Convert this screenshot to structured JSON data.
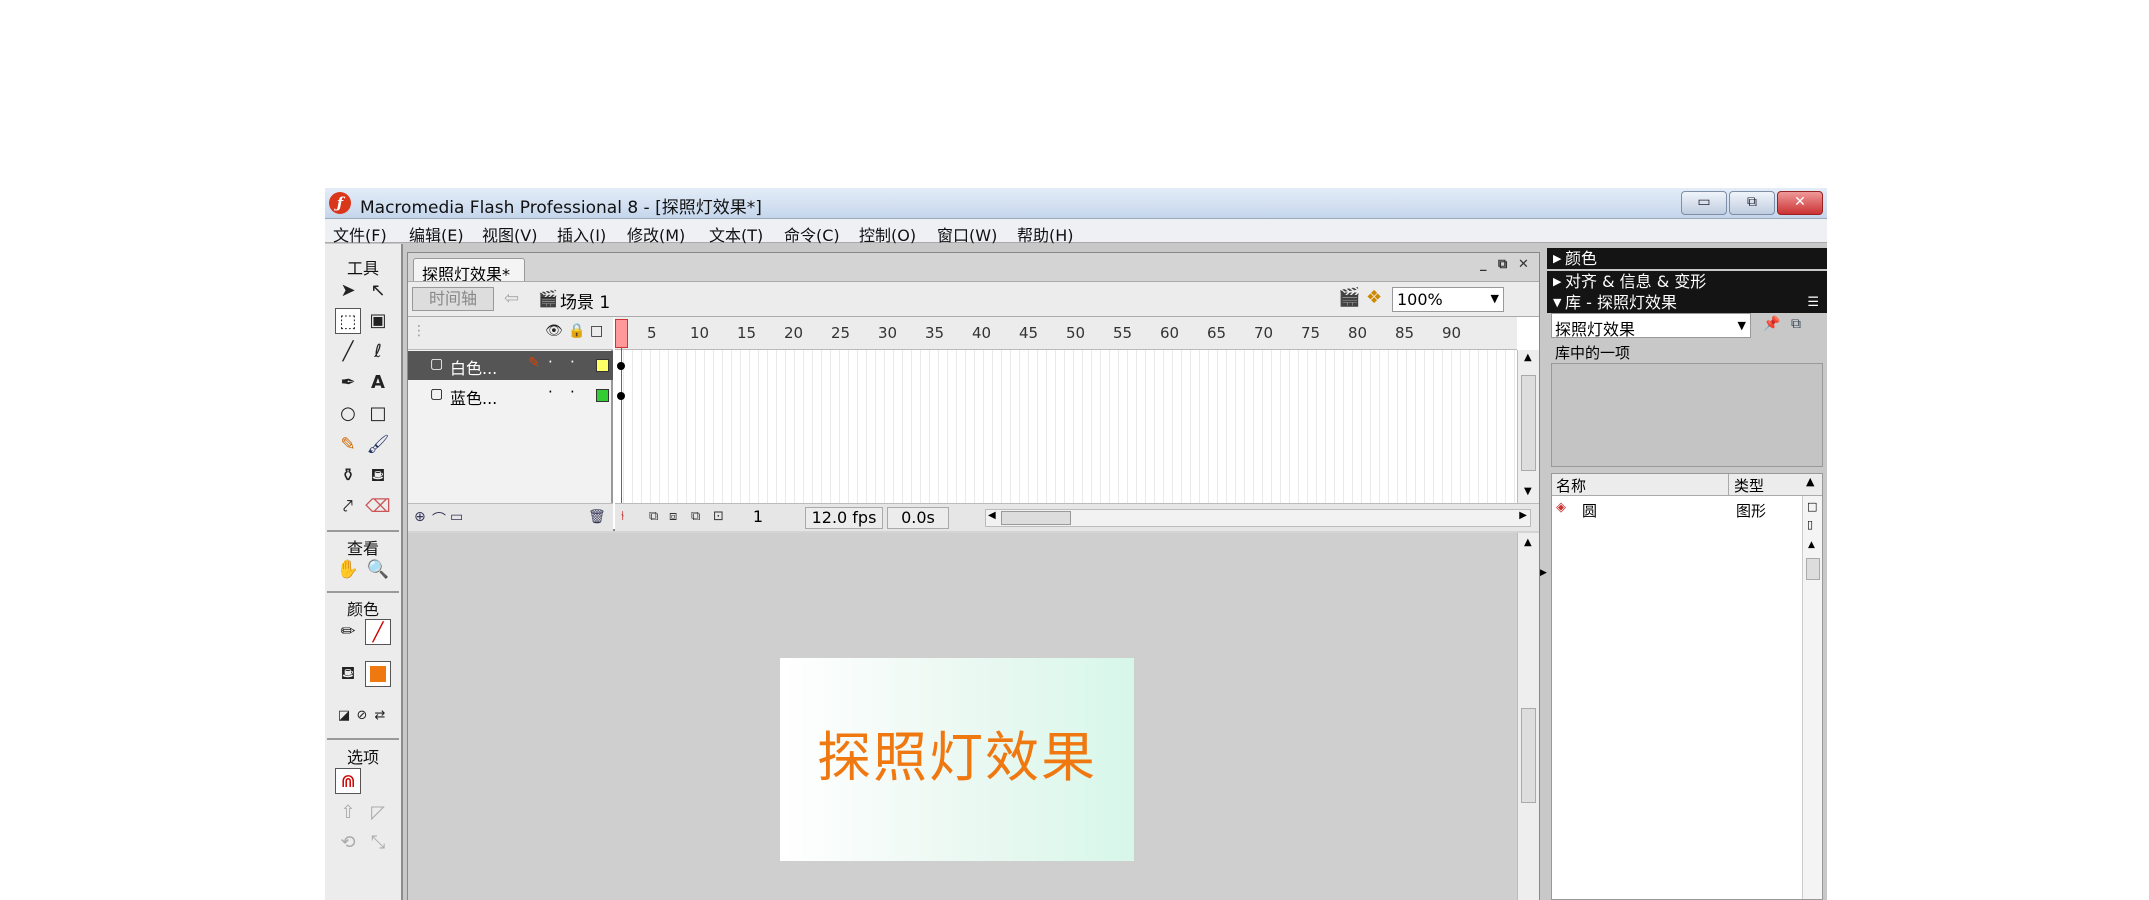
{
  "window": {
    "title": "Macromedia Flash Professional 8 - [探照灯效果*]",
    "logo_glyph": "ƒ",
    "controls": {
      "minimize": "▭",
      "restore": "⧉",
      "close": "✕"
    }
  },
  "menu": [
    "文件(F)",
    "编辑(E)",
    "视图(V)",
    "插入(I)",
    "修改(M)",
    "文本(T)",
    "命令(C)",
    "控制(O)",
    "窗口(W)",
    "帮助(H)"
  ],
  "tools": {
    "title": "工具",
    "view_title": "查看",
    "color_title": "颜色",
    "options_title": "选项",
    "fill_color": "#f07810"
  },
  "document": {
    "tab_label": "探照灯效果*",
    "timeline_button": "时间轴",
    "scene_label": "场景 1",
    "zoom": "100%",
    "doc_min": "_",
    "doc_restore": "⧉",
    "doc_close": "✕"
  },
  "timeline": {
    "layers": [
      {
        "name": "白色...",
        "selected": true,
        "swatch": "#ffff66"
      },
      {
        "name": "蓝色...",
        "selected": false,
        "swatch": "#33cc33"
      }
    ],
    "frame_numbers": [
      "1",
      "5",
      "10",
      "15",
      "20",
      "25",
      "30",
      "35",
      "40",
      "45",
      "50",
      "55",
      "60",
      "65",
      "70",
      "75",
      "80",
      "85",
      "90"
    ],
    "current_frame": "1",
    "fps": "12.0 fps",
    "elapsed": "0.0s"
  },
  "stage": {
    "text": "探照灯效果"
  },
  "panels": {
    "color": "颜色",
    "align_info_transform": "对齐 & 信息 & 变形",
    "library": "库 - 探照灯效果",
    "library_select": "探照灯效果",
    "library_count": "库中的一项",
    "col_name": "名称",
    "col_type": "类型",
    "item_name": "圆",
    "item_type": "图形"
  }
}
